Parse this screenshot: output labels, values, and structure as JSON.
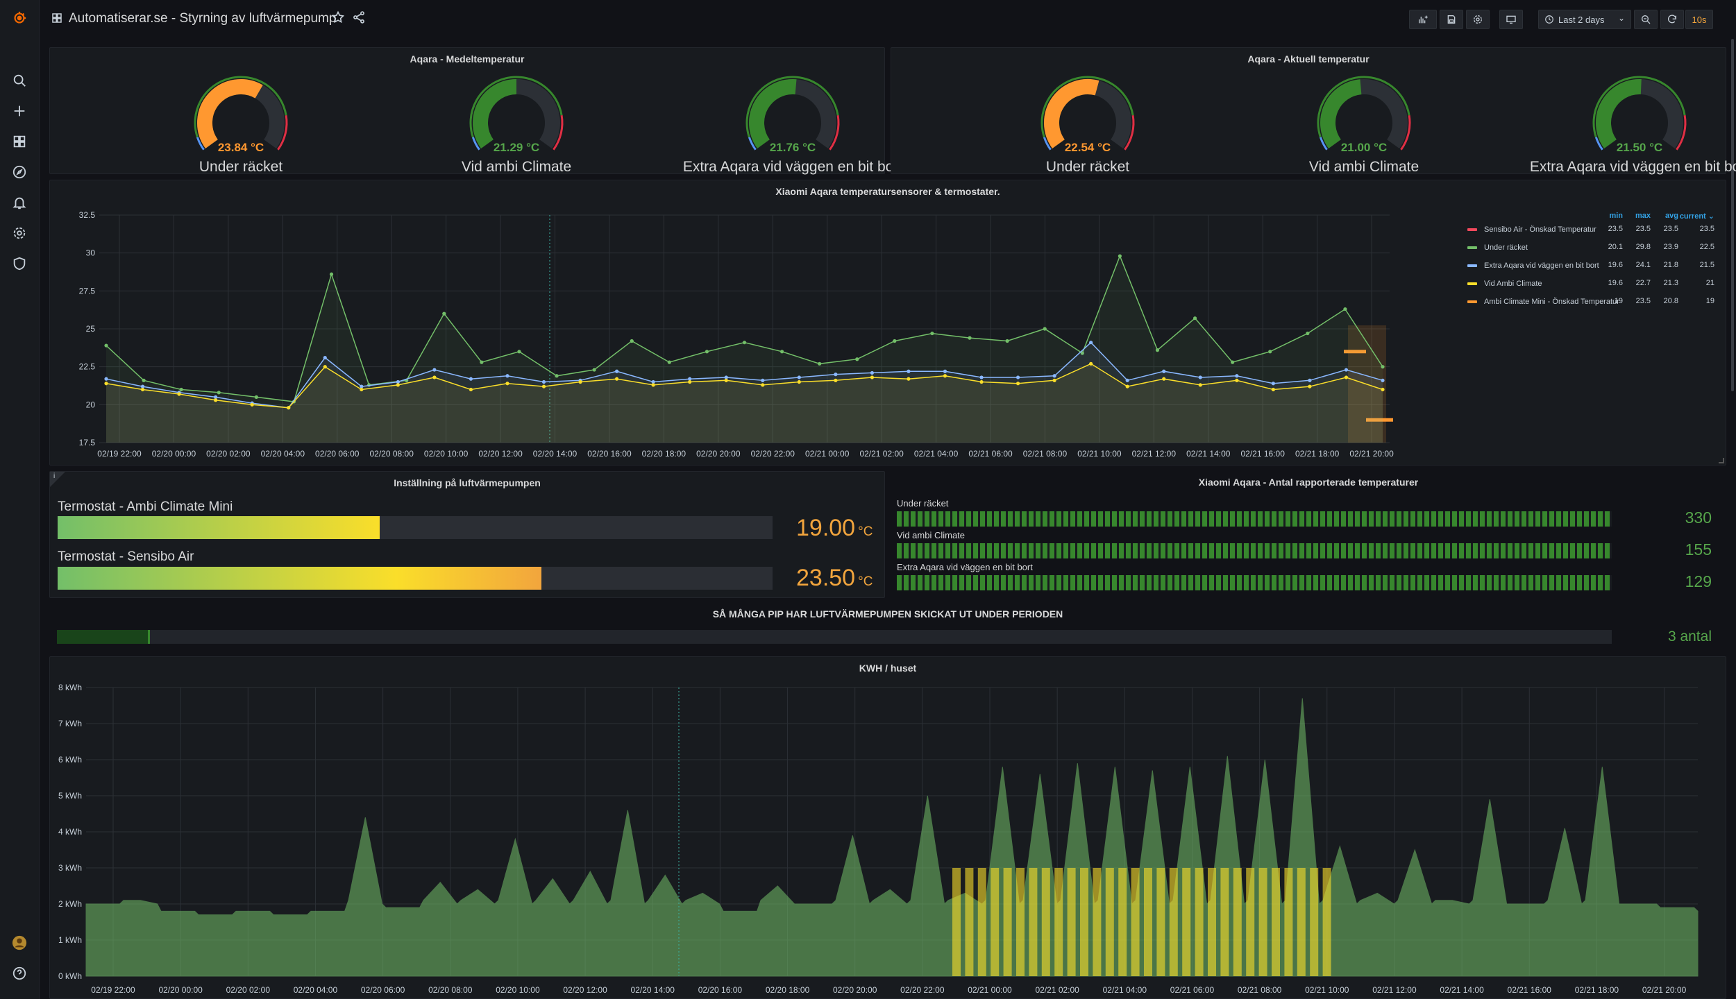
{
  "header": {
    "title": "Automatiserar.se - Styrning av luftvärmepump",
    "time_range": "Last 2 days",
    "refresh": "10s"
  },
  "panels": {
    "avg_temp": {
      "title": "Aqara - Medeltemperatur",
      "gauges": [
        {
          "label": "Under räcket",
          "value": "23.84 °C",
          "fraction": 0.62,
          "color": "#ff9830"
        },
        {
          "label": "Vid ambi Climate",
          "value": "21.29 °C",
          "fraction": 0.5,
          "color": "#37872d"
        },
        {
          "label": "Extra Aqara vid väggen en bit bort",
          "value": "21.76 °C",
          "fraction": 0.52,
          "color": "#37872d"
        }
      ]
    },
    "cur_temp": {
      "title": "Aqara - Aktuell temperatur",
      "gauges": [
        {
          "label": "Under räcket",
          "value": "22.54 °C",
          "fraction": 0.56,
          "color": "#ff9830"
        },
        {
          "label": "Vid ambi Climate",
          "value": "21.00 °C",
          "fraction": 0.48,
          "color": "#37872d"
        },
        {
          "label": "Extra Aqara vid väggen en bit bort",
          "value": "21.50 °C",
          "fraction": 0.51,
          "color": "#37872d"
        }
      ]
    },
    "temp_graph": {
      "title": "Xiaomi Aqara temperatursensorer & termostater."
    },
    "thermostat": {
      "title": "Inställning på luftvärmepumpen",
      "bars": [
        {
          "label": "Termostat - Ambi Climate Mini",
          "value": "19.00",
          "unit": "°C",
          "fraction": 0.45
        },
        {
          "label": "Termostat - Sensibo Air",
          "value": "23.50",
          "unit": "°C",
          "fraction": 0.677
        }
      ]
    },
    "counts": {
      "title": "Xiaomi Aqara - Antal rapporterade temperaturer",
      "rows": [
        {
          "label": "Under räcket",
          "value": "330"
        },
        {
          "label": "Vid ambi Climate",
          "value": "155"
        },
        {
          "label": "Extra Aqara vid väggen en bit bort",
          "value": "129"
        }
      ]
    },
    "pips": {
      "title": "SÅ MÅNGA PIP HAR LUFTVÄRMEPUMPEN SKICKAT UT UNDER PERIODEN",
      "value": "3 antal",
      "fraction": 0.06
    },
    "kwh_graph": {
      "title": "KWH / huset"
    }
  },
  "chart_data": [
    {
      "type": "line",
      "title": "Xiaomi Aqara temperatursensorer & termostater.",
      "x": [
        "02/19 22:00",
        "02/20 00:00",
        "02/20 02:00",
        "02/20 04:00",
        "02/20 06:00",
        "02/20 08:00",
        "02/20 10:00",
        "02/20 12:00",
        "02/20 14:00",
        "02/20 16:00",
        "02/20 18:00",
        "02/20 20:00",
        "02/20 22:00",
        "02/21 00:00",
        "02/21 02:00",
        "02/21 04:00",
        "02/21 06:00",
        "02/21 08:00",
        "02/21 10:00",
        "02/21 12:00",
        "02/21 14:00",
        "02/21 16:00",
        "02/21 18:00",
        "02/21 20:00"
      ],
      "yticks": [
        "17.5",
        "20",
        "22.5",
        "25",
        "27.5",
        "30",
        "32.5"
      ],
      "ylim": [
        17.5,
        32.5
      ],
      "legend_headers": [
        "min",
        "max",
        "avg",
        "current"
      ],
      "series": [
        {
          "name": "Sensibo Air - Önskad Temperatur",
          "color": "#f2495c",
          "min": "23.5",
          "max": "23.5",
          "avg": "23.5",
          "current": "23.5",
          "values": []
        },
        {
          "name": "Under räcket",
          "color": "#73bf69",
          "min": "20.1",
          "max": "29.8",
          "avg": "23.9",
          "current": "22.5",
          "values": [
            23.9,
            21.6,
            21.0,
            20.8,
            20.5,
            20.2,
            28.6,
            21.3,
            21.6,
            26.0,
            22.8,
            23.5,
            21.9,
            22.3,
            24.2,
            22.8,
            23.5,
            24.1,
            23.5,
            22.7,
            23.0,
            24.2,
            24.7,
            24.4,
            24.2,
            25.0,
            23.4,
            29.8,
            23.6,
            25.7,
            22.8,
            23.5,
            24.7,
            26.3,
            22.5
          ]
        },
        {
          "name": "Extra Aqara vid väggen en bit bort",
          "color": "#8ab8ff",
          "min": "19.6",
          "max": "24.1",
          "avg": "21.8",
          "current": "21.5",
          "values": [
            21.7,
            21.2,
            20.8,
            20.5,
            20.1,
            19.8,
            23.1,
            21.2,
            21.5,
            22.3,
            21.7,
            21.9,
            21.5,
            21.6,
            22.2,
            21.5,
            21.7,
            21.8,
            21.6,
            21.8,
            22.0,
            22.1,
            22.2,
            22.2,
            21.8,
            21.8,
            21.9,
            24.1,
            21.6,
            22.2,
            21.8,
            21.9,
            21.4,
            21.6,
            22.3,
            21.6
          ]
        },
        {
          "name": "Vid Ambi Climate",
          "color": "#fade2a",
          "min": "19.6",
          "max": "22.7",
          "avg": "21.3",
          "current": "21",
          "values": [
            21.4,
            21.0,
            20.7,
            20.3,
            20.0,
            19.8,
            22.5,
            21.0,
            21.3,
            21.8,
            21.0,
            21.4,
            21.2,
            21.5,
            21.7,
            21.3,
            21.5,
            21.6,
            21.3,
            21.5,
            21.6,
            21.8,
            21.7,
            21.9,
            21.5,
            21.4,
            21.6,
            22.7,
            21.2,
            21.7,
            21.3,
            21.6,
            21.0,
            21.2,
            21.8,
            21.0
          ]
        },
        {
          "name": "Ambi Climate Mini - Önskad Temperatur",
          "color": "#ff9830",
          "min": "19",
          "max": "23.5",
          "avg": "20.8",
          "current": "19",
          "values": []
        }
      ]
    },
    {
      "type": "bar",
      "title": "KWH / huset",
      "x": [
        "02/19 22:00",
        "02/20 00:00",
        "02/20 02:00",
        "02/20 04:00",
        "02/20 06:00",
        "02/20 08:00",
        "02/20 10:00",
        "02/20 12:00",
        "02/20 14:00",
        "02/20 16:00",
        "02/20 18:00",
        "02/20 20:00",
        "02/20 22:00",
        "02/21 00:00",
        "02/21 02:00",
        "02/21 04:00",
        "02/21 06:00",
        "02/21 08:00",
        "02/21 10:00",
        "02/21 12:00",
        "02/21 14:00",
        "02/21 16:00",
        "02/21 18:00",
        "02/21 20:00"
      ],
      "yticks": [
        "0 kWh",
        "1 kWh",
        "2 kWh",
        "3 kWh",
        "4 kWh",
        "5 kWh",
        "6 kWh",
        "7 kWh",
        "8 kWh"
      ],
      "ylim": [
        0,
        8
      ],
      "series": [
        {
          "name": "",
          "color": "#73bf69",
          "values": [
            2.0,
            2.1,
            1.8,
            1.7,
            1.8,
            1.7,
            1.8,
            4.4,
            1.9,
            2.6,
            2.4,
            3.8,
            2.7,
            2.9,
            4.6,
            2.8,
            2.3,
            1.8,
            2.5,
            2.0,
            3.9,
            2.4,
            5.0,
            2.3,
            5.8,
            5.6,
            5.9,
            5.8,
            5.7,
            5.8,
            6.1,
            6.0,
            7.7,
            3.6,
            2.3,
            3.5,
            2.1,
            4.9,
            2.0,
            4.1,
            5.8,
            2.0,
            1.9
          ]
        },
        {
          "name": "",
          "color": "#fade2a",
          "values": [
            3.0
          ]
        }
      ]
    }
  ]
}
